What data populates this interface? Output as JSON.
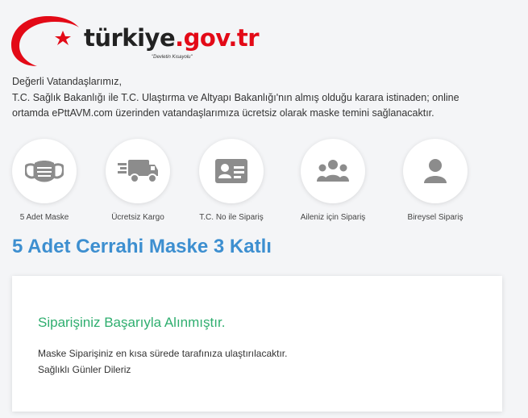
{
  "logo": {
    "brand_main": "türkiye",
    "brand_gov": ".gov.tr",
    "slogan": "\"Devletin Kısayolu\"",
    "colors": {
      "brand_red": "#e30a17",
      "text": "#222222"
    }
  },
  "intro": {
    "greeting": "Değerli Vatandaşlarımız,",
    "line1": "T.C. Sağlık Bakanlığı ile T.C. Ulaştırma ve Altyapı Bakanlığı'nın almış olduğu karara istinaden; online",
    "line2": "ortamda ePttAVM.com üzerinden vatandaşlarımıza ücretsiz olarak maske temini sağlanacaktır."
  },
  "features": [
    {
      "label": "5 Adet Maske",
      "icon": "mask-icon"
    },
    {
      "label": "Ücretsiz Kargo",
      "icon": "truck-icon"
    },
    {
      "label": "T.C. No ile Sipariş",
      "icon": "id-card-icon"
    },
    {
      "label": "Aileniz için Sipariş",
      "icon": "family-icon"
    },
    {
      "label": "Bireysel Sipariş",
      "icon": "user-icon"
    }
  ],
  "product": {
    "title": "5 Adet Cerrahi Maske 3 Katlı"
  },
  "result": {
    "success_title": "Siparişiniz Başarıyla Alınmıştır.",
    "message_line1": "Maske Siparişiniz en kısa sürede tarafınıza ulaştırılacaktır.",
    "message_line2": "Sağlıklı Günler Dileriz"
  },
  "colors": {
    "background": "#f4f5f7",
    "icon_gray": "#8c8c8c",
    "title_blue": "#3d8fd0",
    "success_green": "#2fae6f"
  }
}
